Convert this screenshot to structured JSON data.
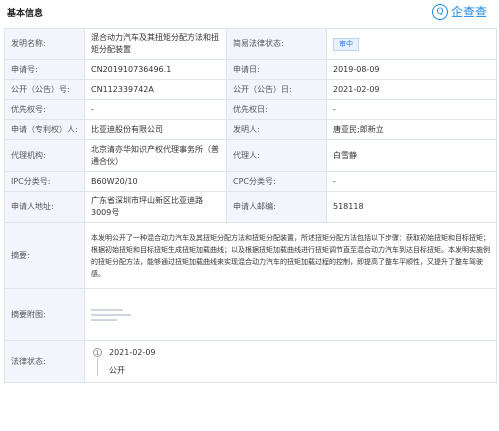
{
  "header": {
    "title": "基本信息",
    "logo_text": "企查查"
  },
  "rows": {
    "name_label": "发明名称:",
    "name_value": "混合动力汽车及其扭矩分配方法和扭矩分配装置",
    "legal_status_label": "简易法律状态:",
    "legal_status_value": "审中",
    "app_no_label": "申请号:",
    "app_no_value": "CN201910736496.1",
    "app_date_label": "申请日:",
    "app_date_value": "2019-08-09",
    "pub_no_label": "公开（公告）号:",
    "pub_no_value": "CN112339742A",
    "pub_date_label": "公开（公告）日:",
    "pub_date_value": "2021-02-09",
    "priority_no_label": "优先权号:",
    "priority_no_value": "-",
    "priority_date_label": "优先权日:",
    "priority_date_value": "-",
    "applicant_label": "申请（专利权）人:",
    "applicant_value": "比亚迪股份有限公司",
    "inventor_label": "发明人:",
    "inventor_value": "唐亚民;郎新立",
    "agency_label": "代理机构:",
    "agency_value": "北京清亦华知识产权代理事务所（普通合伙）",
    "agent_label": "代理人:",
    "agent_value": "白雪静",
    "ipc_label": "IPC分类号:",
    "ipc_value": "B60W20/10",
    "cpc_label": "CPC分类号:",
    "cpc_value": "-",
    "address_label": "申请人地址:",
    "address_value": "广东省深圳市坪山新区比亚迪路3009号",
    "postcode_label": "申请人邮编:",
    "postcode_value": "518118",
    "abstract_label": "摘要:",
    "abstract_value": "本发明公开了一种混合动力汽车及其扭矩分配方法和扭矩分配装置，所述扭矩分配方法包括以下步骤：获取初始扭矩和目标扭矩；根据初始扭矩和目标扭矩生成扭矩加载曲线；以及根据扭矩加载曲线进行扭矩调节直至混合动力汽车到达目标扭矩。本发明实施例的扭矩分配方法，能够通过扭矩加载曲线来实现混合动力汽车的扭矩加载过程的控制，即提高了整车平顺性，又提升了整车驾驶感。",
    "abstract_fig_label": "摘要附图:",
    "legal_status_full_label": "法律状态:",
    "timeline_icon": "1",
    "timeline_date": "2021-02-09",
    "timeline_status": "公开"
  },
  "colors": {
    "accent": "#2c7be5",
    "label_bg": "#f2f6fc",
    "border": "#dfe3ea"
  }
}
